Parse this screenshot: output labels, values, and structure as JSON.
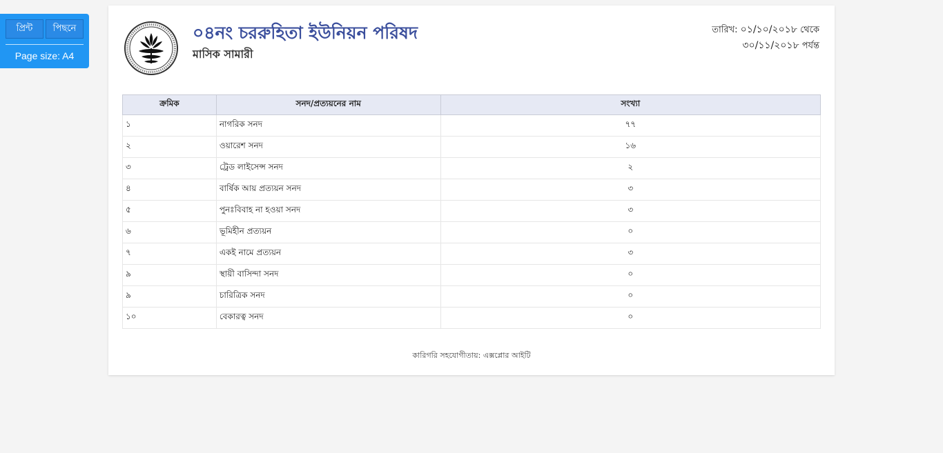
{
  "toolbar": {
    "print_label": "প্রিন্ট",
    "back_label": "পিছনে",
    "page_size_label": "Page size: A4"
  },
  "header": {
    "logo_icon": "bangladesh-government-seal-icon",
    "org_name": "০৪নং চররুহিতা ইউনিয়ন পরিষদ",
    "report_title": "মাসিক সামারী",
    "date_label": "তারিখ:",
    "date_from": "০১/১০/২০১৮",
    "from_word": "থেকে",
    "date_to": "৩০/১১/২০১৮",
    "to_word": "পর্যন্ত"
  },
  "table": {
    "headers": [
      "ক্রমিক",
      "সনদ/প্রত্যয়নের নাম",
      "সংখ্যা"
    ],
    "rows": [
      {
        "serial": "১",
        "name": "নাগরিক সনদ",
        "count": "৭৭"
      },
      {
        "serial": "২",
        "name": "ওয়ারেশ সনদ",
        "count": "১৬"
      },
      {
        "serial": "৩",
        "name": "ট্রেড লাইসেন্স সনদ",
        "count": "২"
      },
      {
        "serial": "৪",
        "name": "বার্ষিক আয় প্রত্যয়ন সনদ",
        "count": "৩"
      },
      {
        "serial": "৫",
        "name": "পুনঃবিবাহ না হওয়া সনদ",
        "count": "৩"
      },
      {
        "serial": "৬",
        "name": "ভূমিহীন প্রত্যয়ন",
        "count": "০"
      },
      {
        "serial": "৭",
        "name": "একই নামে প্রত্যয়ন",
        "count": "৩"
      },
      {
        "serial": "৯",
        "name": "স্থায়ী বাসিন্দা সনদ",
        "count": "০"
      },
      {
        "serial": "৯",
        "name": "চারিত্রিক সনদ",
        "count": "০"
      },
      {
        "serial": "১০",
        "name": "বেকারত্ব সনদ",
        "count": "০"
      }
    ]
  },
  "footer": {
    "credit": "কারিগরি সহযোগীতায়: এক্সপ্লোর আইটি"
  },
  "colors": {
    "toolbar_bg": "#2196f3",
    "org_name": "#3a4e9c",
    "table_header_bg": "#e6e9f4"
  }
}
